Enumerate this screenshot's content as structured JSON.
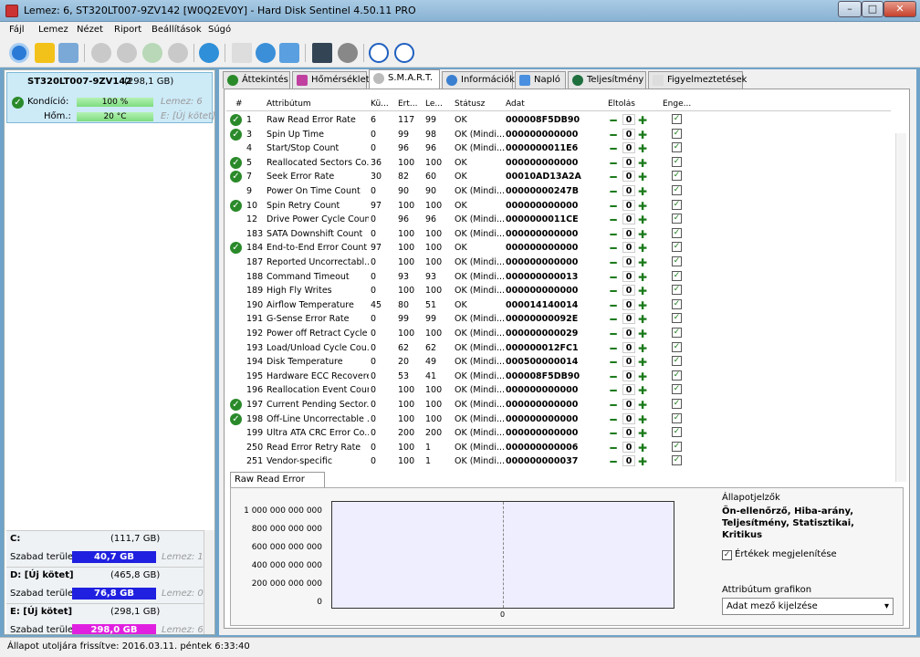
{
  "window": {
    "title": "Lemez: 6, ST320LT007-9ZV142 [W0Q2EV0Y]  -  Hard Disk Sentinel 4.50.11 PRO",
    "controls": [
      "–",
      "□",
      "✕"
    ]
  },
  "menu": [
    "Fájl",
    "Lemez",
    "Nézet",
    "Riport",
    "Beállítások",
    "Súgó"
  ],
  "disk": {
    "name": "ST320LT007-9ZV142",
    "size": "(298,1 GB)",
    "condition_label": "Kondíció:",
    "condition_value": "100 %",
    "condition_level": 1.0,
    "condition_note": "Lemez: 6",
    "temp_label": "Hőm.:",
    "temp_value": "20 °C",
    "temp_note": "E: [Új kötet]"
  },
  "volumes": [
    {
      "name": "C:",
      "size": "(111,7 GB)",
      "free_label": "Szabad terület",
      "free": "40,7 GB",
      "note": "Lemez: 1",
      "color": "#2020e0"
    },
    {
      "name": "D: [Új kötet]",
      "size": "(465,8 GB)",
      "free_label": "Szabad terület",
      "free": "76,8 GB",
      "note": "Lemez: 0",
      "color": "#2020e0"
    },
    {
      "name": "E: [Új kötet]",
      "size": "(298,1 GB)",
      "free_label": "Szabad terület",
      "free": "298,0 GB",
      "note": "Lemez: 6",
      "color": "#e020e0"
    }
  ],
  "tabs": [
    "Áttekintés",
    "Hőmérséklet",
    "S.M.A.R.T.",
    "Információk",
    "Napló",
    "Teljesítmény",
    "Figyelmeztetések"
  ],
  "active_tab": "S.M.A.R.T.",
  "smart": {
    "headers": [
      "#",
      "Attribútum",
      "Kü...",
      "Ért...",
      "Le...",
      "Státusz",
      "Adat",
      "Eltolás",
      "Enge..."
    ],
    "rows": [
      {
        "ok": true,
        "id": "1",
        "name": "Raw Read Error Rate",
        "thr": "6",
        "val": "117",
        "worst": "99",
        "status": "OK",
        "data": "000008F5DB90",
        "offset": "0"
      },
      {
        "ok": true,
        "id": "3",
        "name": "Spin Up Time",
        "thr": "0",
        "val": "99",
        "worst": "98",
        "status": "OK (Mindi...",
        "data": "000000000000",
        "offset": "0"
      },
      {
        "ok": false,
        "id": "4",
        "name": "Start/Stop Count",
        "thr": "0",
        "val": "96",
        "worst": "96",
        "status": "OK (Mindi...",
        "data": "0000000011E6",
        "offset": "0"
      },
      {
        "ok": true,
        "id": "5",
        "name": "Reallocated Sectors Co...",
        "thr": "36",
        "val": "100",
        "worst": "100",
        "status": "OK",
        "data": "000000000000",
        "offset": "0"
      },
      {
        "ok": true,
        "id": "7",
        "name": "Seek Error Rate",
        "thr": "30",
        "val": "82",
        "worst": "60",
        "status": "OK",
        "data": "00010AD13A2A",
        "offset": "0"
      },
      {
        "ok": false,
        "id": "9",
        "name": "Power On Time Count",
        "thr": "0",
        "val": "90",
        "worst": "90",
        "status": "OK (Mindi...",
        "data": "00000000247B",
        "offset": "0"
      },
      {
        "ok": true,
        "id": "10",
        "name": "Spin Retry Count",
        "thr": "97",
        "val": "100",
        "worst": "100",
        "status": "OK",
        "data": "000000000000",
        "offset": "0"
      },
      {
        "ok": false,
        "id": "12",
        "name": "Drive Power Cycle Count",
        "thr": "0",
        "val": "96",
        "worst": "96",
        "status": "OK (Mindi...",
        "data": "0000000011CE",
        "offset": "0"
      },
      {
        "ok": false,
        "id": "183",
        "name": "SATA Downshift Count",
        "thr": "0",
        "val": "100",
        "worst": "100",
        "status": "OK (Mindi...",
        "data": "000000000000",
        "offset": "0"
      },
      {
        "ok": true,
        "id": "184",
        "name": "End-to-End Error Count",
        "thr": "97",
        "val": "100",
        "worst": "100",
        "status": "OK",
        "data": "000000000000",
        "offset": "0"
      },
      {
        "ok": false,
        "id": "187",
        "name": "Reported Uncorrectabl...",
        "thr": "0",
        "val": "100",
        "worst": "100",
        "status": "OK (Mindi...",
        "data": "000000000000",
        "offset": "0"
      },
      {
        "ok": false,
        "id": "188",
        "name": "Command Timeout",
        "thr": "0",
        "val": "93",
        "worst": "93",
        "status": "OK (Mindi...",
        "data": "000000000013",
        "offset": "0"
      },
      {
        "ok": false,
        "id": "189",
        "name": "High Fly Writes",
        "thr": "0",
        "val": "100",
        "worst": "100",
        "status": "OK (Mindi...",
        "data": "000000000000",
        "offset": "0"
      },
      {
        "ok": false,
        "id": "190",
        "name": "Airflow Temperature",
        "thr": "45",
        "val": "80",
        "worst": "51",
        "status": "OK",
        "data": "000014140014",
        "offset": "0"
      },
      {
        "ok": false,
        "id": "191",
        "name": "G-Sense Error Rate",
        "thr": "0",
        "val": "99",
        "worst": "99",
        "status": "OK (Mindi...",
        "data": "00000000092E",
        "offset": "0"
      },
      {
        "ok": false,
        "id": "192",
        "name": "Power off Retract Cycle ...",
        "thr": "0",
        "val": "100",
        "worst": "100",
        "status": "OK (Mindi...",
        "data": "000000000029",
        "offset": "0"
      },
      {
        "ok": false,
        "id": "193",
        "name": "Load/Unload Cycle Cou...",
        "thr": "0",
        "val": "62",
        "worst": "62",
        "status": "OK (Mindi...",
        "data": "000000012FC1",
        "offset": "0"
      },
      {
        "ok": false,
        "id": "194",
        "name": "Disk Temperature",
        "thr": "0",
        "val": "20",
        "worst": "49",
        "status": "OK (Mindi...",
        "data": "000500000014",
        "offset": "0"
      },
      {
        "ok": false,
        "id": "195",
        "name": "Hardware ECC Recovered",
        "thr": "0",
        "val": "53",
        "worst": "41",
        "status": "OK (Mindi...",
        "data": "000008F5DB90",
        "offset": "0"
      },
      {
        "ok": false,
        "id": "196",
        "name": "Reallocation Event Count",
        "thr": "0",
        "val": "100",
        "worst": "100",
        "status": "OK (Mindi...",
        "data": "000000000000",
        "offset": "0"
      },
      {
        "ok": true,
        "id": "197",
        "name": "Current Pending Sector...",
        "thr": "0",
        "val": "100",
        "worst": "100",
        "status": "OK (Mindi...",
        "data": "000000000000",
        "offset": "0"
      },
      {
        "ok": true,
        "id": "198",
        "name": "Off-Line Uncorrectable ...",
        "thr": "0",
        "val": "100",
        "worst": "100",
        "status": "OK (Mindi...",
        "data": "000000000000",
        "offset": "0"
      },
      {
        "ok": false,
        "id": "199",
        "name": "Ultra ATA CRC Error Co...",
        "thr": "0",
        "val": "200",
        "worst": "200",
        "status": "OK (Mindi...",
        "data": "000000000000",
        "offset": "0"
      },
      {
        "ok": false,
        "id": "250",
        "name": "Read Error Retry Rate",
        "thr": "0",
        "val": "100",
        "worst": "1",
        "status": "OK (Mindi...",
        "data": "000000000006",
        "offset": "0"
      },
      {
        "ok": false,
        "id": "251",
        "name": "Vendor-specific",
        "thr": "0",
        "val": "100",
        "worst": "1",
        "status": "OK (Mindi...",
        "data": "000000000037",
        "offset": "0"
      }
    ]
  },
  "graph": {
    "tab_label": "Raw Read Error Rate",
    "y_ticks": [
      "1 000 000 000 000",
      "800 000 000 000",
      "600 000 000 000",
      "400 000 000 000",
      "200 000 000 000",
      "0"
    ],
    "x_tick": "0",
    "indicators_title": "Állapotjelzők",
    "indicators_text": "Ön-ellenőrző, Hiba-arány, Teljesítmény, Statisztikai, Kritikus",
    "show_values_label": "Értékek megjelenítése",
    "attr_graph_label": "Attribútum grafikon",
    "attr_graph_select": "Adat mező kijelzése"
  },
  "status": "Állapot utoljára frissítve: 2016.03.11. péntek 6:33:40"
}
